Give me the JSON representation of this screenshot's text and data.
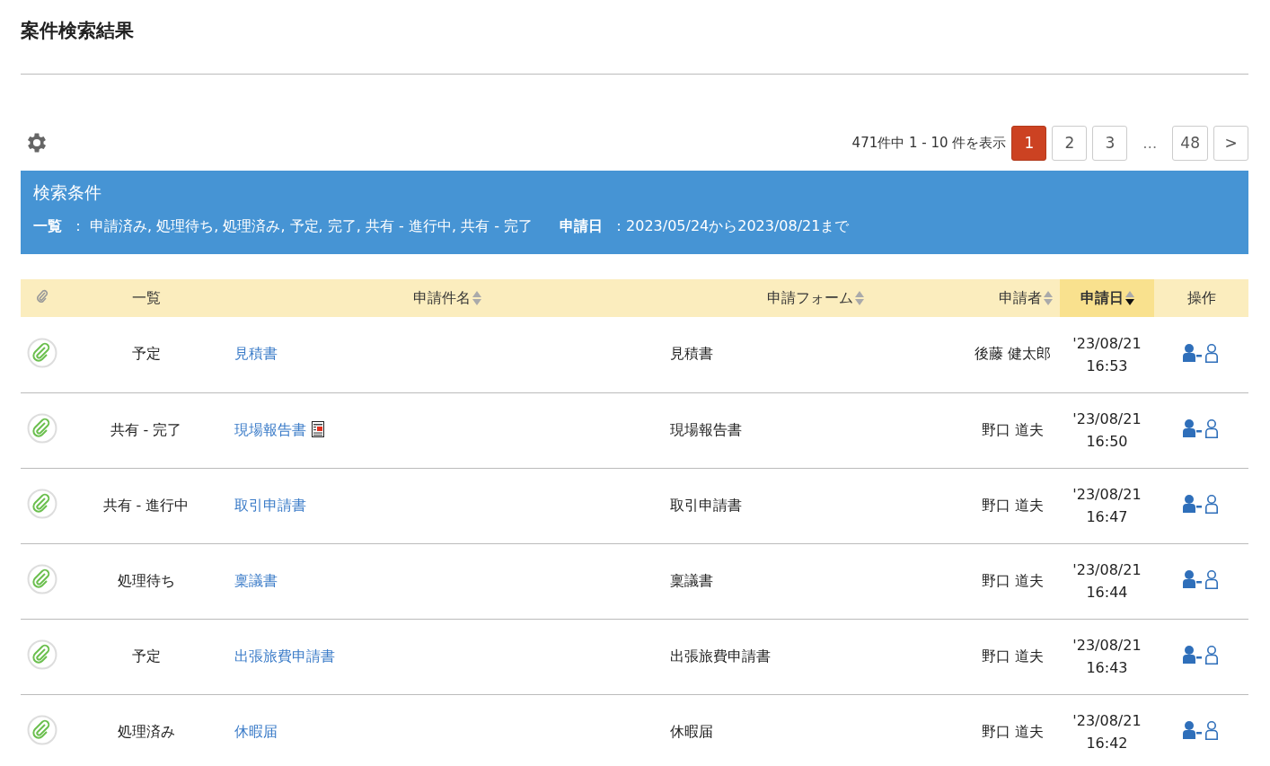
{
  "title": "案件検索結果",
  "summary": "471件中 1 - 10 件を表示",
  "pages": [
    {
      "kind": "page",
      "label": "1",
      "selected": true
    },
    {
      "kind": "page",
      "label": "2",
      "selected": false
    },
    {
      "kind": "page",
      "label": "3",
      "selected": false
    },
    {
      "kind": "ellipsis",
      "label": "…",
      "selected": false
    },
    {
      "kind": "page",
      "label": "48",
      "selected": false
    },
    {
      "kind": "next",
      "label": ">",
      "selected": false
    }
  ],
  "conditions": {
    "title": "検索条件",
    "items": [
      {
        "label": "一覧",
        "value": "：  申請済み, 処理待ち, 処理済み, 予定, 完了, 共有 - 進行中, 共有 - 完了"
      },
      {
        "label": "申請日",
        "value": "：2023/05/24から2023/08/21まで"
      }
    ]
  },
  "columns": [
    {
      "kind": "clip",
      "sortable": false,
      "selected": false
    },
    {
      "kind": "status",
      "label": "一覧",
      "sortable": false,
      "selected": false
    },
    {
      "kind": "name",
      "label": "申請件名",
      "sortable": true,
      "selected": false
    },
    {
      "kind": "form",
      "label": "申請フォーム",
      "sortable": true,
      "selected": false
    },
    {
      "kind": "applicant",
      "label": "申請者",
      "sortable": true,
      "selected": false
    },
    {
      "kind": "date",
      "label": "申請日",
      "sortable": true,
      "selected": true
    },
    {
      "kind": "ops",
      "label": "操作",
      "sortable": false,
      "selected": false
    }
  ],
  "rows": [
    {
      "status": "予定",
      "name": "見積書",
      "has_document": false,
      "form": "見積書",
      "applicant": "後藤 健太郎",
      "date": "'23/08/21",
      "time": "16:53"
    },
    {
      "status": "共有 - 完了",
      "name": "現場報告書",
      "has_document": true,
      "form": "現場報告書",
      "applicant": "野口 道夫",
      "date": "'23/08/21",
      "time": "16:50"
    },
    {
      "status": "共有 - 進行中",
      "name": "取引申請書",
      "has_document": false,
      "form": "取引申請書",
      "applicant": "野口 道夫",
      "date": "'23/08/21",
      "time": "16:47"
    },
    {
      "status": "処理待ち",
      "name": "稟議書",
      "has_document": false,
      "form": "稟議書",
      "applicant": "野口 道夫",
      "date": "'23/08/21",
      "time": "16:44"
    },
    {
      "status": "予定",
      "name": "出張旅費申請書",
      "has_document": false,
      "form": "出張旅費申請書",
      "applicant": "野口 道夫",
      "date": "'23/08/21",
      "time": "16:43"
    },
    {
      "status": "処理済み",
      "name": "休暇届",
      "has_document": false,
      "form": "休暇届",
      "applicant": "野口 道夫",
      "date": "'23/08/21",
      "time": "16:42"
    }
  ]
}
